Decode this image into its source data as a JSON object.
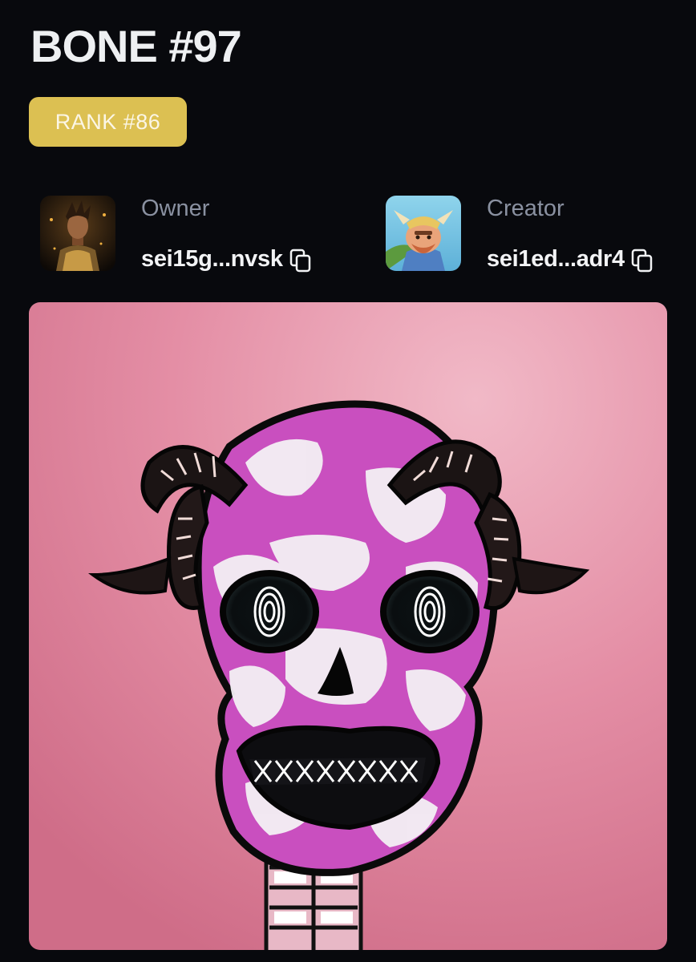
{
  "nft": {
    "title": "BONE #97",
    "rank_label": "RANK #86"
  },
  "owner": {
    "label": "Owner",
    "address": "sei15g...nvsk",
    "avatar_icon": "owner-avatar"
  },
  "creator": {
    "label": "Creator",
    "address": "sei1ed...adr4",
    "avatar_icon": "creator-avatar"
  },
  "colors": {
    "background": "#08090d",
    "rank_badge": "#dcc052",
    "label_gray": "#8a91a1",
    "artwork_bg": "#e28ca3"
  }
}
